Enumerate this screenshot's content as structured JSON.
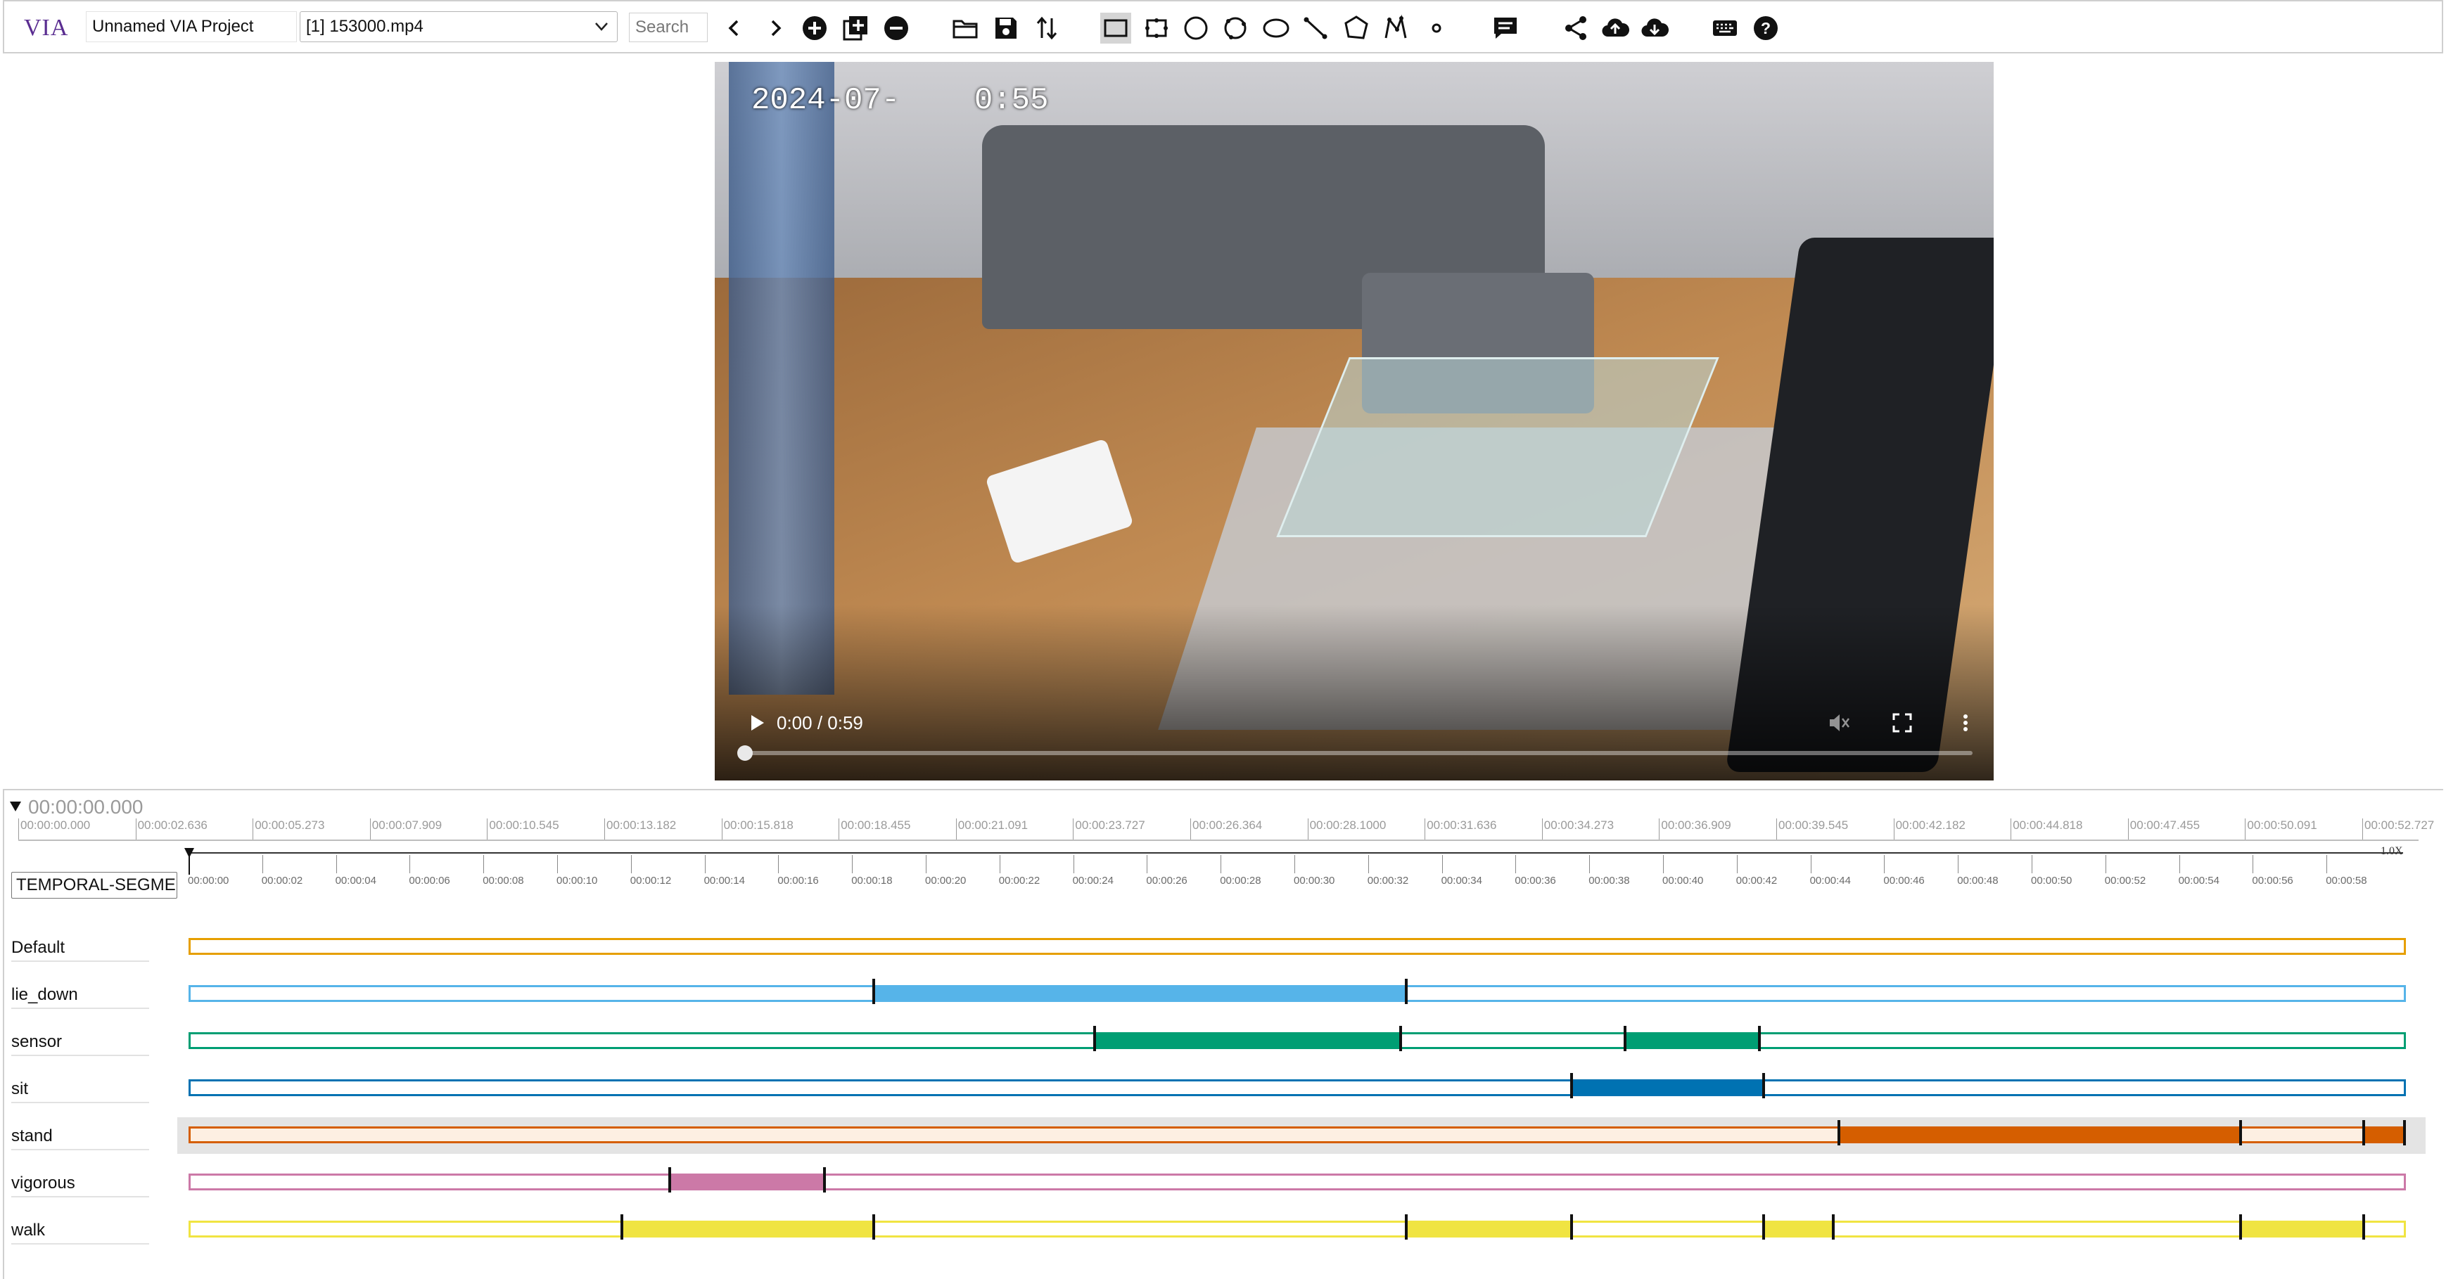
{
  "app": {
    "logo": "VIA",
    "project_name": "Unnamed VIA Project",
    "selected_file": "[1] 153000.mp4",
    "search_placeholder": "Search"
  },
  "toolbar_icons": [
    "prev-file-icon",
    "next-file-icon",
    "add-file-icon",
    "add-multiple-files-icon",
    "remove-file-icon",
    "open-project-icon",
    "save-project-icon",
    "import-export-icon",
    "rectangle-shape-icon",
    "extreme-rectangle-icon",
    "circle-shape-icon",
    "extreme-circle-icon",
    "ellipse-shape-icon",
    "line-shape-icon",
    "polygon-shape-icon",
    "polyline-shape-icon",
    "point-shape-icon",
    "temporal-segment-icon",
    "share-icon",
    "upload-icon",
    "download-icon",
    "keyboard-shortcuts-icon",
    "help-icon"
  ],
  "video": {
    "timestamp_overlay": "2024-07-",
    "timestamp_overlay_tail": "0:55",
    "time_text": "0:00 / 0:59",
    "progress": 0
  },
  "timeline": {
    "current_time": "00:00:00.000",
    "zoom_label": "1.0X",
    "attribute_select": "TEMPORAL-SEGMENTS",
    "full_ruler_ticks": [
      "00:00:00.000",
      "00:00:02.636",
      "00:00:05.273",
      "00:00:07.909",
      "00:00:10.545",
      "00:00:13.182",
      "00:00:15.818",
      "00:00:18.455",
      "00:00:21.091",
      "00:00:23.727",
      "00:00:26.364",
      "00:00:28.1000",
      "00:00:31.636",
      "00:00:34.273",
      "00:00:36.909",
      "00:00:39.545",
      "00:00:42.182",
      "00:00:44.818",
      "00:00:47.455",
      "00:00:50.091",
      "00:00:52.727"
    ],
    "zoom_ruler_ticks": [
      "00:00:00",
      "00:00:02",
      "00:00:04",
      "00:00:06",
      "00:00:08",
      "00:00:10",
      "00:00:12",
      "00:00:14",
      "00:00:16",
      "00:00:18",
      "00:00:20",
      "00:00:22",
      "00:00:24",
      "00:00:26",
      "00:00:28",
      "00:00:30",
      "00:00:32",
      "00:00:34",
      "00:00:36",
      "00:00:38",
      "00:00:40",
      "00:00:42",
      "00:00:44",
      "00:00:46",
      "00:00:48",
      "00:00:50",
      "00:00:52",
      "00:00:54",
      "00:00:56",
      "00:00:58"
    ],
    "duration_seconds": 60.2,
    "tracks": [
      {
        "label": "Default",
        "color": "#e69f00",
        "segments": []
      },
      {
        "label": "lie_down",
        "color": "#56b4e9",
        "segments": [
          [
            18.55,
            33.0
          ]
        ]
      },
      {
        "label": "sensor",
        "color": "#009e73",
        "segments": [
          [
            24.55,
            32.85
          ],
          [
            38.95,
            42.6
          ]
        ]
      },
      {
        "label": "sit",
        "color": "#0072b2",
        "segments": [
          [
            37.5,
            42.7
          ]
        ]
      },
      {
        "label": "stand",
        "color": "#d55e00",
        "selected": true,
        "segments": [
          [
            44.75,
            55.65
          ],
          [
            59.0,
            60.1
          ]
        ]
      },
      {
        "label": "vigorous",
        "color": "#cc79a7",
        "segments": [
          [
            13.0,
            17.2
          ]
        ]
      },
      {
        "label": "walk",
        "color": "#f0e442",
        "segments": [
          [
            11.7,
            18.55
          ],
          [
            33.0,
            37.5
          ],
          [
            42.7,
            44.6
          ],
          [
            55.65,
            59.0
          ]
        ]
      }
    ]
  }
}
